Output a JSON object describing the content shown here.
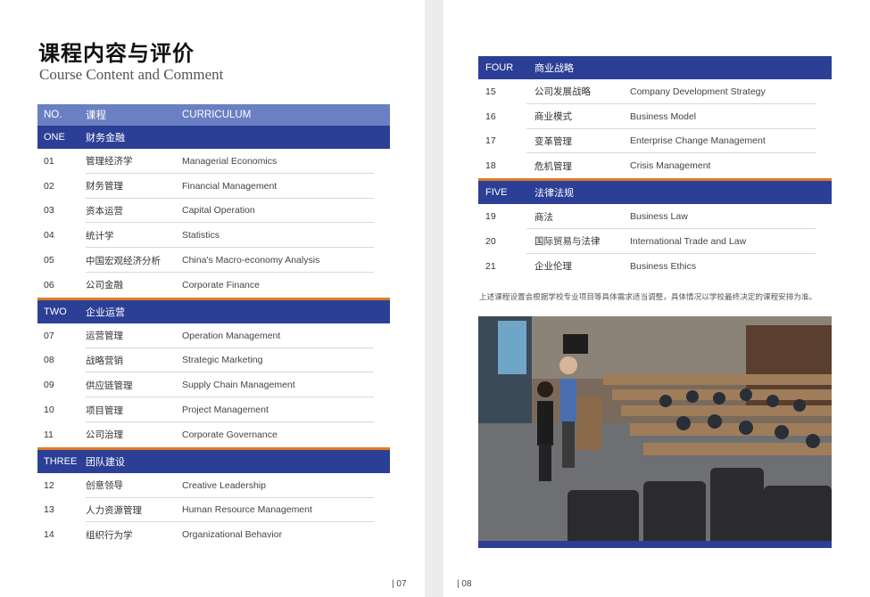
{
  "left_page": {
    "title_cn": "课程内容与评价",
    "title_en": "Course Content and Comment",
    "header": {
      "no": "NO.",
      "cn": "课程",
      "en": "CURRICULUM"
    },
    "sections": [
      {
        "no": "ONE",
        "name": "财务金融",
        "rows": [
          {
            "no": "01",
            "cn": "管理经济学",
            "en": "Managerial Economics"
          },
          {
            "no": "02",
            "cn": "财务管理",
            "en": "Financial Management"
          },
          {
            "no": "03",
            "cn": "资本运营",
            "en": "Capital Operation"
          },
          {
            "no": "04",
            "cn": "统计学",
            "en": "Statistics"
          },
          {
            "no": "05",
            "cn": "中国宏观经济分析",
            "en": "China's Macro-economy Analysis"
          },
          {
            "no": "06",
            "cn": "公司金融",
            "en": "Corporate Finance"
          }
        ]
      },
      {
        "no": "TWO",
        "name": "企业运营",
        "rows": [
          {
            "no": "07",
            "cn": "运营管理",
            "en": "Operation Management"
          },
          {
            "no": "08",
            "cn": "战略营销",
            "en": "Strategic Marketing"
          },
          {
            "no": "09",
            "cn": "供应链管理",
            "en": "Supply Chain Management"
          },
          {
            "no": "10",
            "cn": "项目管理",
            "en": "Project Management"
          },
          {
            "no": "11",
            "cn": "公司治理",
            "en": "Corporate Governance"
          }
        ]
      },
      {
        "no": "THREE",
        "name": "团队建设",
        "rows": [
          {
            "no": "12",
            "cn": "创意领导",
            "en": "Creative Leadership"
          },
          {
            "no": "13",
            "cn": "人力资源管理",
            "en": "Human Resource Management"
          },
          {
            "no": "14",
            "cn": "组织行为学",
            "en": "Organizational Behavior"
          }
        ]
      }
    ],
    "page_number": "| 07"
  },
  "right_page": {
    "sections": [
      {
        "no": "FOUR",
        "name": "商业战略",
        "rows": [
          {
            "no": "15",
            "cn": "公司发展战略",
            "en": "Company Development Strategy"
          },
          {
            "no": "16",
            "cn": "商业模式",
            "en": "Business Model"
          },
          {
            "no": "17",
            "cn": "变革管理",
            "en": "Enterprise Change Management"
          },
          {
            "no": "18",
            "cn": "危机管理",
            "en": "Crisis Management"
          }
        ]
      },
      {
        "no": "FIVE",
        "name": "法律法规",
        "rows": [
          {
            "no": "19",
            "cn": "商法",
            "en": "Business Law"
          },
          {
            "no": "20",
            "cn": "国际贸易与法律",
            "en": "International Trade and Law"
          },
          {
            "no": "21",
            "cn": "企业伦理",
            "en": "Business Ethics"
          }
        ]
      }
    ],
    "note": "上述课程设置会根据学校专业项目等具体需求适当调整，具体情况以学校最终决定的课程安排为准。",
    "page_number": "| 08"
  },
  "colors": {
    "section_blue": "#2c3f96",
    "header_blue": "#6a80c2",
    "accent_orange": "#e07b26"
  }
}
